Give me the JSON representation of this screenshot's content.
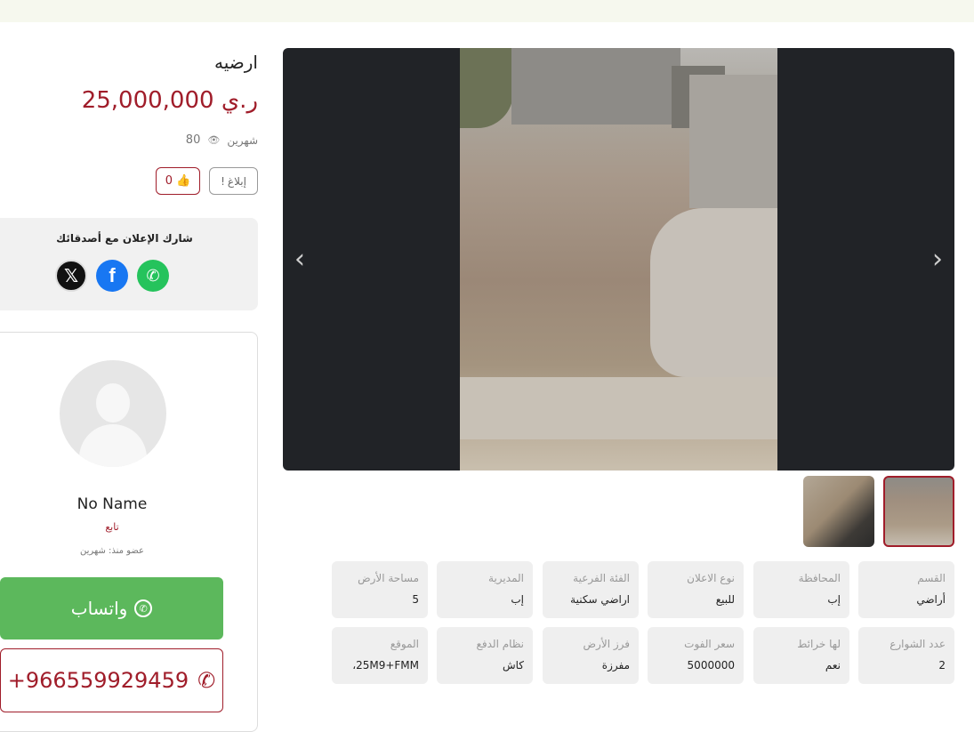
{
  "listing": {
    "title": "ارضيه",
    "price": "25,000,000 ر.ي",
    "age": "شهرين",
    "views": "80",
    "report_label": "إبلاغ",
    "likes": "0"
  },
  "share": {
    "title": "شارك الإعلان مع أصدقائك",
    "networks": [
      "x-icon",
      "facebook-icon",
      "whatsapp-icon"
    ]
  },
  "seller": {
    "name": "No Name",
    "role": "تابع",
    "member_since": "عضو منذ: شهرين"
  },
  "contact": {
    "whatsapp_label": "واتساب",
    "phone": "+966559929459"
  },
  "gallery": {
    "thumb_count": 2,
    "active_thumb": 1
  },
  "details": [
    {
      "label": "القسم",
      "value": "أراضي"
    },
    {
      "label": "المحافظة",
      "value": "إب"
    },
    {
      "label": "نوع الاعلان",
      "value": "للبيع"
    },
    {
      "label": "الفئة الفرعية",
      "value": "اراضي سكنية"
    },
    {
      "label": "المديرية",
      "value": "إب"
    },
    {
      "label": "مساحة الأرض",
      "value": "5"
    },
    {
      "label": "عدد الشوارع",
      "value": "2"
    },
    {
      "label": "لها خرائط",
      "value": "نعم"
    },
    {
      "label": "سعر الفوت",
      "value": "5000000"
    },
    {
      "label": "فرز الأرض",
      "value": "مفرزة"
    },
    {
      "label": "نظام الدفع",
      "value": "كاش"
    },
    {
      "label": "الموقع",
      "value": "25M9+FMM، "
    }
  ],
  "colors": {
    "accent": "#a01d2a",
    "whatsapp": "#5cb85c",
    "topbar": "#f6f8ee"
  }
}
